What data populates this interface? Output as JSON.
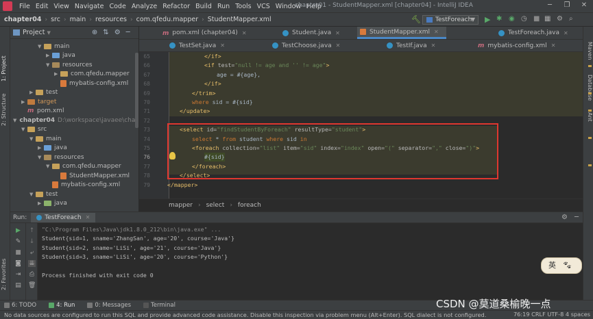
{
  "menu": [
    "File",
    "Edit",
    "View",
    "Navigate",
    "Code",
    "Analyze",
    "Refactor",
    "Build",
    "Run",
    "Tools",
    "VCS",
    "Window",
    "Help"
  ],
  "window_title": "chapter01 - StudentMapper.xml [chapter04] - IntelliJ IDEA",
  "breadcrumbs": [
    "chapter04",
    "src",
    "main",
    "resources",
    "com.qfedu.mapper",
    "StudentMapper.xml"
  ],
  "run_config": "TestForeach",
  "project_panel": {
    "title": "Project",
    "tree": [
      {
        "indent": 3,
        "arrow": "▼",
        "icon": "folder",
        "label": "main"
      },
      {
        "indent": 4,
        "arrow": "▶",
        "icon": "folder blue",
        "label": "java"
      },
      {
        "indent": 4,
        "arrow": "▼",
        "icon": "folder res",
        "label": "resources"
      },
      {
        "indent": 5,
        "arrow": "▶",
        "icon": "folder",
        "label": "com.qfedu.mapper"
      },
      {
        "indent": 5,
        "arrow": "",
        "icon": "xml",
        "label": "mybatis-config.xml"
      },
      {
        "indent": 2,
        "arrow": "▶",
        "icon": "folder",
        "label": "test"
      },
      {
        "indent": 1,
        "arrow": "▶",
        "icon": "folder orange",
        "label": "target"
      },
      {
        "indent": 1,
        "arrow": "",
        "icon": "m",
        "label": "pom.xml"
      },
      {
        "indent": 0,
        "arrow": "▼",
        "icon": "folder",
        "label": "chapter04",
        "path": "D:\\workspace\\javaee\\chapter"
      },
      {
        "indent": 1,
        "arrow": "▼",
        "icon": "folder",
        "label": "src"
      },
      {
        "indent": 2,
        "arrow": "▼",
        "icon": "folder",
        "label": "main"
      },
      {
        "indent": 3,
        "arrow": "▶",
        "icon": "folder blue",
        "label": "java"
      },
      {
        "indent": 3,
        "arrow": "▼",
        "icon": "folder res",
        "label": "resources"
      },
      {
        "indent": 4,
        "arrow": "▼",
        "icon": "folder",
        "label": "com.qfedu.mapper"
      },
      {
        "indent": 5,
        "arrow": "",
        "icon": "xml",
        "label": "StudentMapper.xml"
      },
      {
        "indent": 4,
        "arrow": "",
        "icon": "xml",
        "label": "mybatis-config.xml"
      },
      {
        "indent": 2,
        "arrow": "▼",
        "icon": "folder",
        "label": "test"
      },
      {
        "indent": 3,
        "arrow": "▶",
        "icon": "folder green",
        "label": "java"
      }
    ]
  },
  "tabs_row1": [
    {
      "label": "pom.xml (chapter04)",
      "icon": "m"
    },
    {
      "label": "Student.java",
      "icon": "class"
    },
    {
      "label": "StudentMapper.xml",
      "icon": "xml",
      "active": true
    },
    {
      "label": "TestForeach.java",
      "icon": "class"
    }
  ],
  "tabs_row2": [
    {
      "label": "TestSet.java",
      "icon": "class"
    },
    {
      "label": "TestChoose.java",
      "icon": "class"
    },
    {
      "label": "TestIf.java",
      "icon": "class"
    },
    {
      "label": "mybatis-config.xml",
      "icon": "m"
    }
  ],
  "line_numbers": [
    "65",
    "66",
    "67",
    "68",
    "69",
    "70",
    "71",
    "72",
    "73",
    "74",
    "75",
    "76",
    "77",
    "78",
    "79"
  ],
  "code": {
    "l65": "</if>",
    "l66a": "<if ",
    "l66b": "test=",
    "l66c": "\"null != age and '' != age\"",
    "l66d": ">",
    "l67": "age = #{age},",
    "l68": "</if>",
    "l69": "</trim>",
    "l70a": "where",
    "l70b": " sid = #{sid}",
    "l71": "</update>",
    "l73a": "<select ",
    "l73b": "id=",
    "l73c": "\"findStudentByForeach\"",
    "l73d": " resultType=",
    "l73e": "\"student\"",
    "l73f": ">",
    "l74a": "select",
    "l74b": " * ",
    "l74c": "from",
    "l74d": " student ",
    "l74e": "where",
    "l74f": " sid ",
    "l74g": "in",
    "l75a": "<foreach ",
    "l75b": "collection=",
    "l75c": "\"list\"",
    "l75d": " item=",
    "l75e": "\"sid\"",
    "l75f": " index=",
    "l75g": "\"index\"",
    "l75h": " open=",
    "l75i": "\"(\"",
    "l75j": " separator=",
    "l75k": "\",\"",
    "l75l": " close=",
    "l75m": "\")\"",
    "l75n": ">",
    "l76": "#{sid}",
    "l77": "</foreach>",
    "l78": "</select>",
    "l79": "</mapper>"
  },
  "editor_breadcrumb": [
    "mapper",
    "select",
    "foreach"
  ],
  "run_panel": {
    "label": "Run:",
    "tab": "TestForeach",
    "output": [
      "\"C:\\Program Files\\Java\\jdk1.8.0_212\\bin\\java.exe\" ...",
      "Student{sid=1, sname='ZhangSan', age='20', course='Java'}",
      "Student{sid=2, sname='LiSi', age='21', course='Java'}",
      "Student{sid=3, sname='LiSi', age='20', course='Python'}",
      "",
      "Process finished with exit code 0"
    ]
  },
  "bottom_tabs": [
    "6: TODO",
    "4: Run",
    "0: Messages",
    "Terminal"
  ],
  "status_message": "No data sources are configured to run this SQL and provide advanced code assistance. Disable this inspection via problem menu (Alt+Enter). SQL dialect is not configured.",
  "status_right": "76:19   CRLF   UTF-8   4 spaces",
  "watermark": "CSDN @莫道桑榆晚一点",
  "ime_label": "英",
  "side_tabs_left": [
    "1: Project",
    "2: Structure",
    "2: Favorites"
  ],
  "side_tabs_right": [
    "Maven",
    "Database",
    "Ant"
  ]
}
